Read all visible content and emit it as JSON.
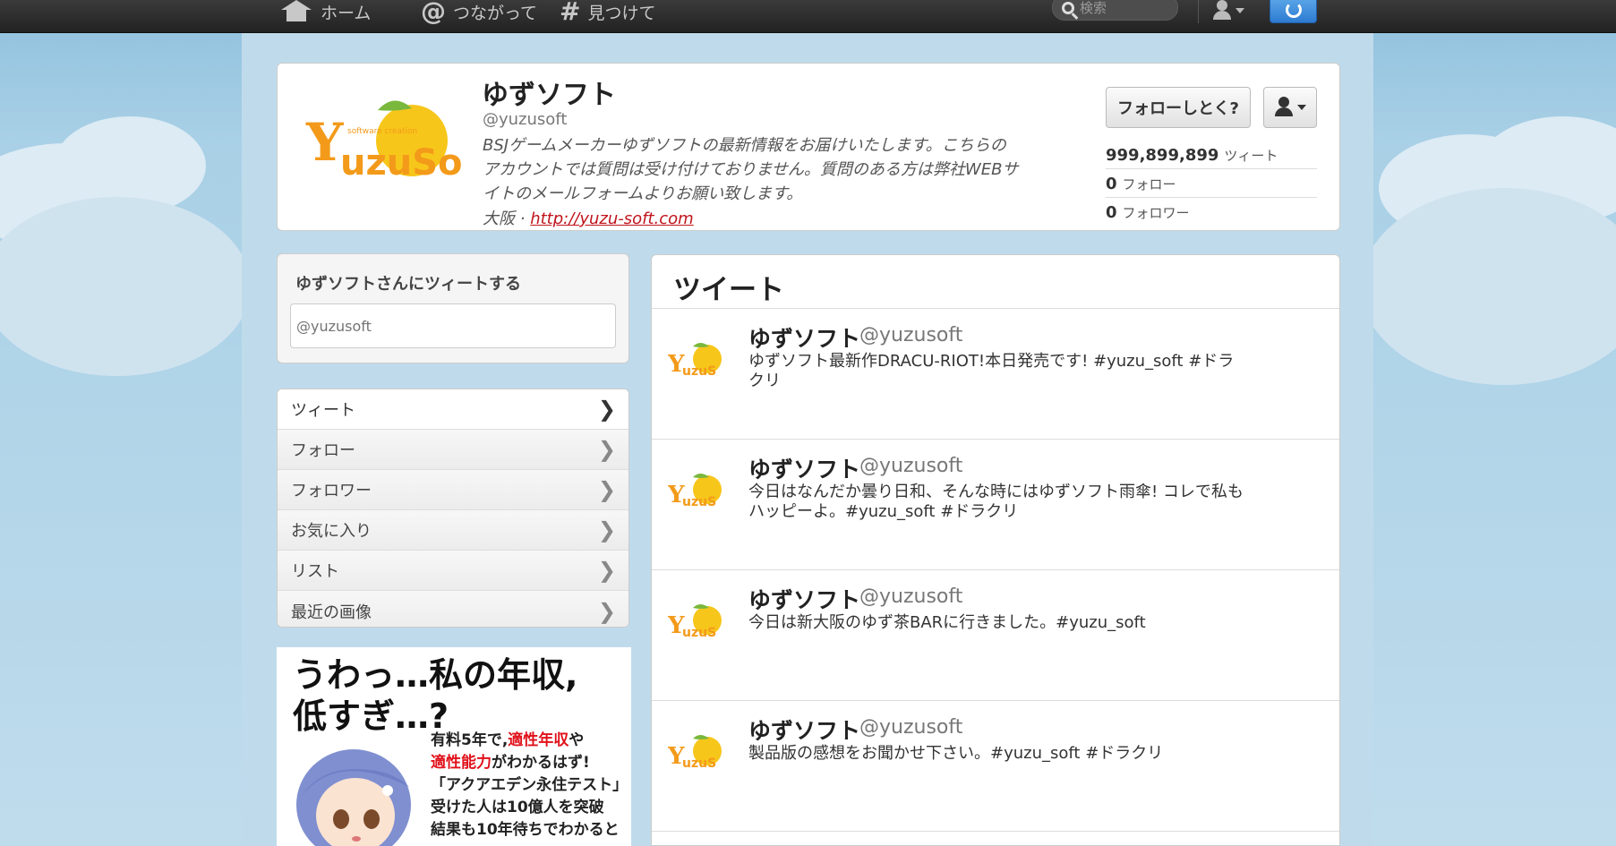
{
  "topbar": {
    "home_label": "ホーム",
    "connect_label": "つながって",
    "discover_label": "見つけて",
    "search_placeholder": "検索"
  },
  "profile": {
    "name": "ゆずソフト",
    "handle": "@yuzusoft",
    "bio": "BSJゲームメーカーゆずソフトの最新情報をお届けいたします。こちらのアカウントでは質問は受け付けておりません。質問のある方は弊社WEBサイトのメールフォームよりお願い致します。",
    "location": "大阪",
    "separator": "·",
    "url": "http://yuzu-soft.com",
    "follow_label": "フォローしとく?",
    "stats": [
      {
        "num": "999,899,899",
        "label": "ツィート"
      },
      {
        "num": "0",
        "label": "フォロー"
      },
      {
        "num": "0",
        "label": "フォロワー"
      }
    ]
  },
  "tweet_to": {
    "title": "ゆずソフトさんにツィートする",
    "placeholder": "@yuzusoft"
  },
  "sidenav": {
    "items": [
      {
        "label": "ツィート"
      },
      {
        "label": "フォロー"
      },
      {
        "label": "フォロワー"
      },
      {
        "label": "お気に入り"
      },
      {
        "label": "リスト"
      },
      {
        "label": "最近の画像"
      }
    ]
  },
  "ad": {
    "headline_1": "うわっ…私の年収,",
    "headline_2": "低すぎ…?",
    "line1_pre": "有料5年で,",
    "line1_hl": "適性年収",
    "line1_post": "や",
    "line2_hl": "適性能力",
    "line2_post": "がわかるはず!",
    "line3": "「アクアエデン永住テスト」",
    "line4": "受けた人は10億人を突破",
    "line5": "結果も10年待ちでわかると"
  },
  "tweets": {
    "header": "ツイート",
    "items": [
      {
        "name": "ゆずソフト",
        "handle": "@yuzusoft",
        "text": "ゆずソフト最新作DRACU-RIOT!本日発売です! #yuzu_soft #ドラクリ"
      },
      {
        "name": "ゆずソフト",
        "handle": "@yuzusoft",
        "text": "今日はなんだか曇り日和、そんな時にはゆずソフト雨傘! コレで私もハッピーよ。#yuzu_soft #ドラクリ"
      },
      {
        "name": "ゆずソフト",
        "handle": "@yuzusoft",
        "text": "今日は新大阪のゆず茶BARに行きました。#yuzu_soft"
      },
      {
        "name": "ゆずソフト",
        "handle": "@yuzusoft",
        "text": "製品版の感想をお聞かせ下さい。#yuzu_soft #ドラクリ"
      }
    ]
  },
  "colors": {
    "accent": "#c0141c",
    "topbar": "#2b2b2b",
    "background": "#a9cfe4"
  }
}
